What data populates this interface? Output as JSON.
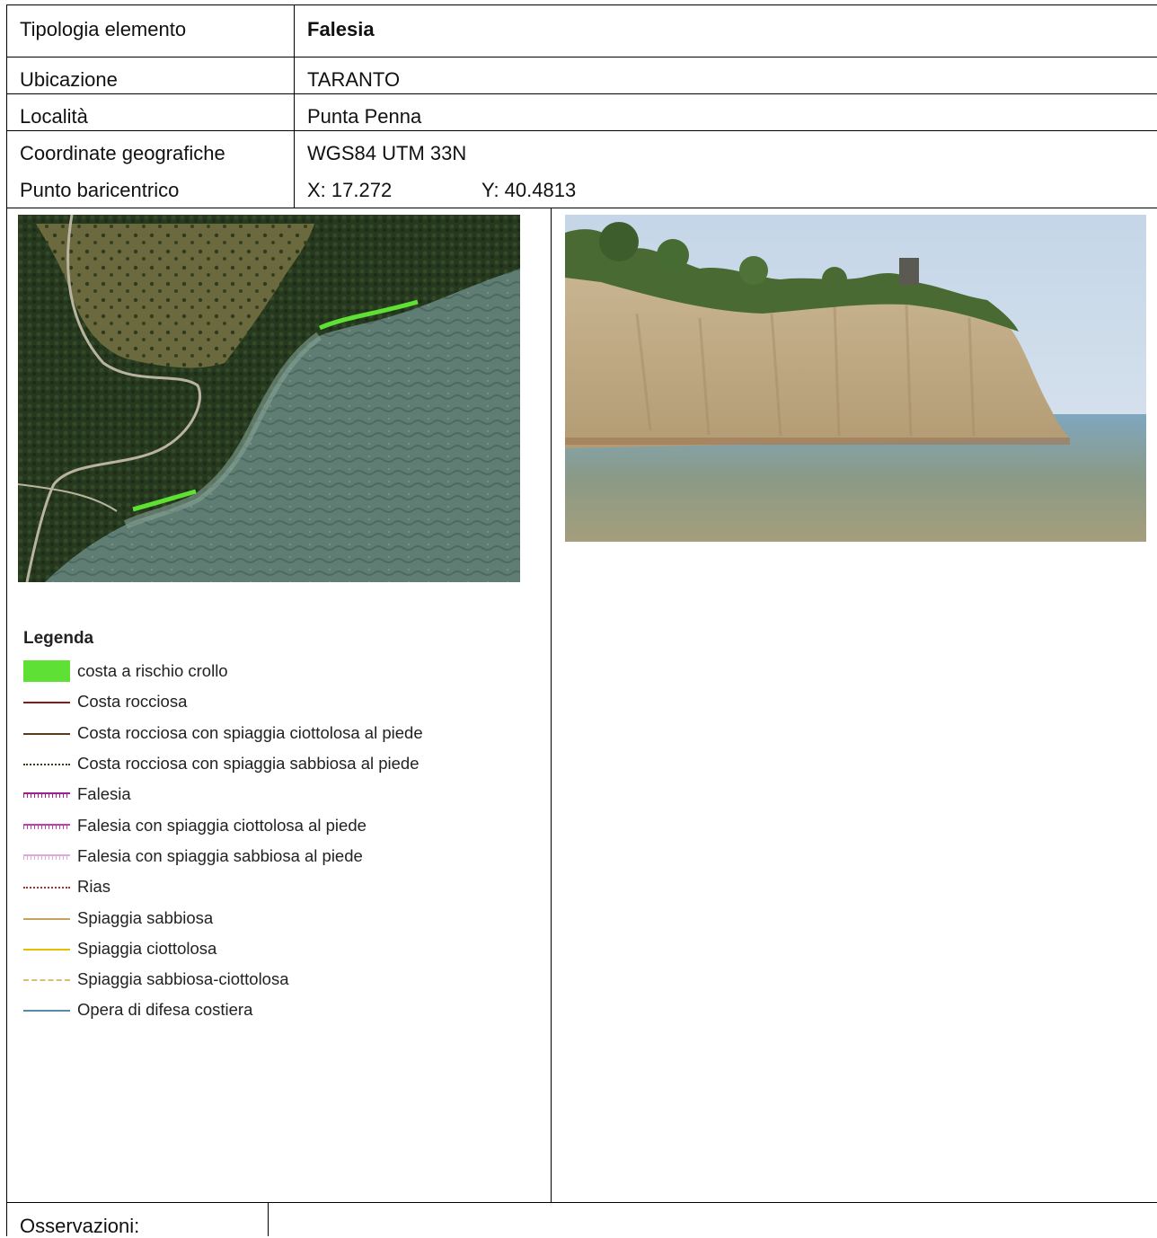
{
  "header_rows": [
    {
      "label": "Tipologia elemento",
      "value": "Falesia"
    },
    {
      "label": "Ubicazione",
      "value": "TARANTO"
    },
    {
      "label": "Località",
      "value": "Punta Penna"
    },
    {
      "label": "Coordinate geografiche",
      "value": "WGS84 UTM 33N"
    },
    {
      "label": "Punto baricentrico",
      "value_x": "X: 17.272",
      "value_y": "Y: 40.4813"
    }
  ],
  "legend": {
    "title": "Legenda",
    "items": [
      {
        "label": "costa a rischio crollo",
        "color": "#5fe034",
        "style": "fill"
      },
      {
        "label": "Costa rocciosa",
        "color": "#8b1a1a",
        "style": "solid"
      },
      {
        "label": "Costa rocciosa con spiaggia ciottolosa al piede",
        "color": "#5a3b1c",
        "style": "solid"
      },
      {
        "label": "Costa rocciosa con spiaggia sabbiosa al piede",
        "color": "#3a3a1a",
        "style": "dashdot"
      },
      {
        "label": "Falesia",
        "color": "#a0208c",
        "style": "ticks"
      },
      {
        "label": "Falesia con spiaggia ciottolosa al piede",
        "color": "#c040b0",
        "style": "ticks"
      },
      {
        "label": "Falesia con spiaggia sabbiosa al piede",
        "color": "#e0a8d8",
        "style": "ticks"
      },
      {
        "label": "Rias",
        "color": "#b02828",
        "style": "dashdot"
      },
      {
        "label": "Spiaggia sabbiosa",
        "color": "#c8a060",
        "style": "solid"
      },
      {
        "label": "Spiaggia ciottolosa",
        "color": "#e0c000",
        "style": "solid"
      },
      {
        "label": "Spiaggia sabbiosa-ciottolosa",
        "color": "#d8c070",
        "style": "dashed"
      },
      {
        "label": "Opera di difesa costiera",
        "color": "#5a8aa8",
        "style": "solid"
      }
    ]
  },
  "footer": {
    "label": "Osservazioni:"
  }
}
